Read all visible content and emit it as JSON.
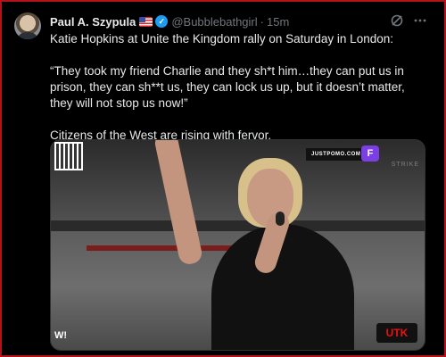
{
  "tweet": {
    "author_name": "Paul A. Szypula",
    "handle": "@Bubblebathgirl",
    "separator": "·",
    "time": "15m",
    "verified_symbol": "✓",
    "paragraphs": [
      "Katie Hopkins at Unite the Kingdom rally on Saturday in London:",
      "“They took my friend Charlie and they sh*t him…they can put us in prison, they can sh**t us, they can lock us up, but it doesn’t matter, they will not stop us now!”",
      "Citizens of the West are rising with fervor."
    ]
  },
  "icons": {
    "flag": "us-flag-icon",
    "verified": "verified-badge-icon",
    "grok": "grok-icon",
    "more": "more-icon"
  },
  "media": {
    "brand_text": "JUSTPOMO.COM",
    "brand_logo": "F",
    "corner_logo": "STRIKE",
    "left_watermark": "W!",
    "right_watermark": "UTK"
  },
  "colors": {
    "accent": "#1d9bf0",
    "border": "#b3121b"
  }
}
